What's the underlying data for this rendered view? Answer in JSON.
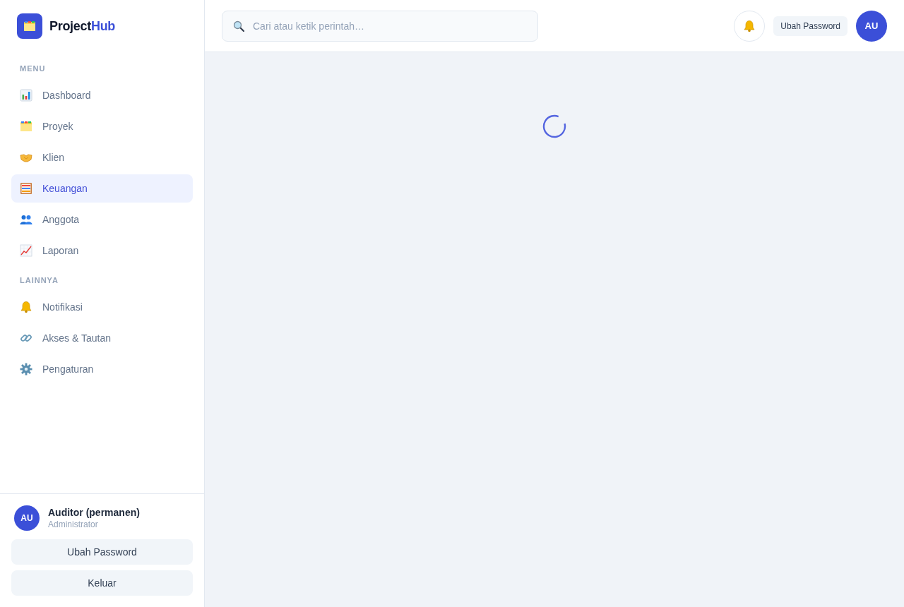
{
  "brand": {
    "name": "Project",
    "accent": "Hub"
  },
  "sidebar": {
    "sections": [
      {
        "title": "MENU",
        "items": [
          {
            "label": "Dashboard",
            "selected": false
          },
          {
            "label": "Proyek",
            "selected": false
          },
          {
            "label": "Klien",
            "selected": false
          },
          {
            "label": "Keuangan",
            "selected": true
          },
          {
            "label": "Anggota",
            "selected": false
          },
          {
            "label": "Laporan",
            "selected": false
          }
        ]
      },
      {
        "title": "LAINNYA",
        "items": [
          {
            "label": "Notifikasi",
            "selected": false
          },
          {
            "label": "Akses & Tautan",
            "selected": false
          },
          {
            "label": "Pengaturan",
            "selected": false
          }
        ]
      }
    ],
    "user": {
      "initials": "AU",
      "name": "Auditor (permanen)",
      "role": "Administrator"
    },
    "buttons": [
      "Ubah Password",
      "Keluar"
    ]
  },
  "header": {
    "search": {
      "placeholder": "Cari atau ketik perintah…"
    },
    "change_password_button": "Ubah Password",
    "avatar_initials": "AU"
  },
  "main": {
    "loading": true
  }
}
